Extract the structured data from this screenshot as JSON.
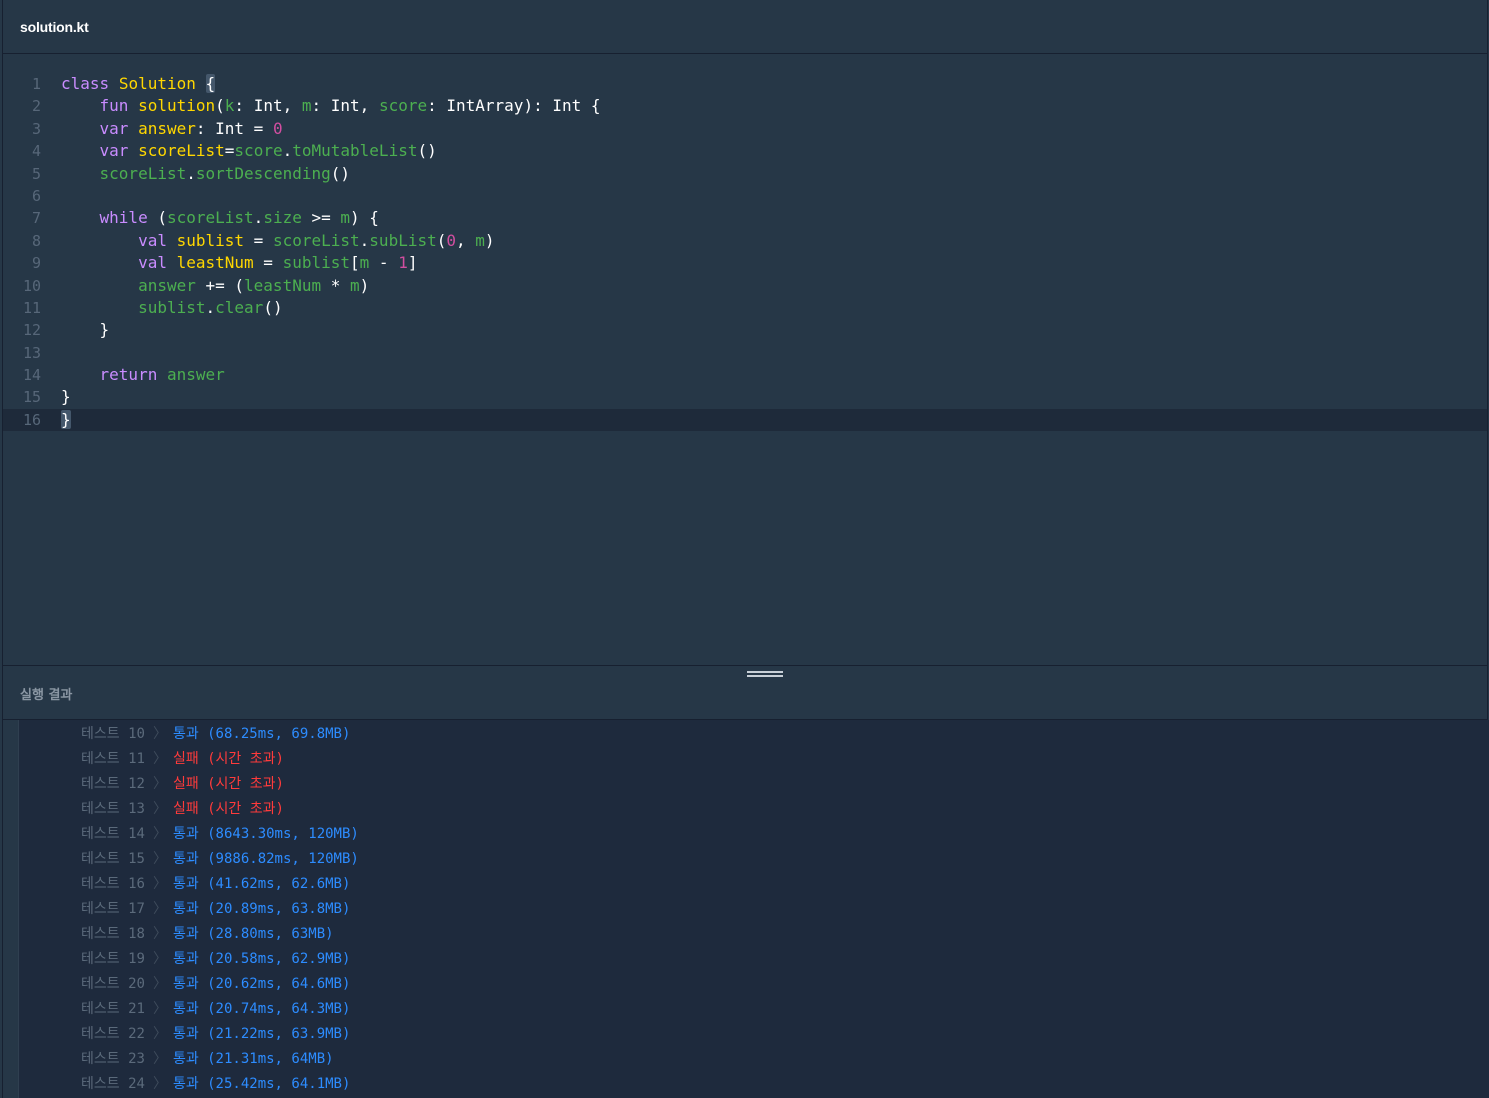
{
  "tab": {
    "title": "solution.kt"
  },
  "editor": {
    "line_numbers": [
      "1",
      "2",
      "3",
      "4",
      "5",
      "6",
      "7",
      "8",
      "9",
      "10",
      "11",
      "12",
      "13",
      "14",
      "15",
      "16"
    ]
  },
  "results": {
    "title": "실행 결과",
    "rows": [
      {
        "label": "테스트 10",
        "separator": "〉",
        "status": "통과 (68.25ms, 69.8MB)"
      },
      {
        "label": "테스트 11",
        "separator": "〉",
        "status": "실패 (시간 초과)"
      },
      {
        "label": "테스트 12",
        "separator": "〉",
        "status": "실패 (시간 초과)"
      },
      {
        "label": "테스트 13",
        "separator": "〉",
        "status": "실패 (시간 초과)"
      },
      {
        "label": "테스트 14",
        "separator": "〉",
        "status": "통과 (8643.30ms, 120MB)"
      },
      {
        "label": "테스트 15",
        "separator": "〉",
        "status": "통과 (9886.82ms, 120MB)"
      },
      {
        "label": "테스트 16",
        "separator": "〉",
        "status": "통과 (41.62ms, 62.6MB)"
      },
      {
        "label": "테스트 17",
        "separator": "〉",
        "status": "통과 (20.89ms, 63.8MB)"
      },
      {
        "label": "테스트 18",
        "separator": "〉",
        "status": "통과 (28.80ms, 63MB)"
      },
      {
        "label": "테스트 19",
        "separator": "〉",
        "status": "통과 (20.58ms, 62.9MB)"
      },
      {
        "label": "테스트 20",
        "separator": "〉",
        "status": "통과 (20.62ms, 64.6MB)"
      },
      {
        "label": "테스트 21",
        "separator": "〉",
        "status": "통과 (20.74ms, 64.3MB)"
      },
      {
        "label": "테스트 22",
        "separator": "〉",
        "status": "통과 (21.22ms, 63.9MB)"
      },
      {
        "label": "테스트 23",
        "separator": "〉",
        "status": "통과 (21.31ms, 64MB)"
      },
      {
        "label": "테스트 24",
        "separator": "〉",
        "status": "통과 (25.42ms, 64.1MB)"
      }
    ]
  },
  "colors": {
    "background": "#263747",
    "keyword": "#c98cff",
    "function": "#ffd700",
    "identifier": "#4caf50",
    "number": "#d14ea0",
    "pass": "#2d8cff",
    "fail": "#ff3b3b"
  },
  "icons": {
    "splitter": "drag-handle-icon"
  }
}
